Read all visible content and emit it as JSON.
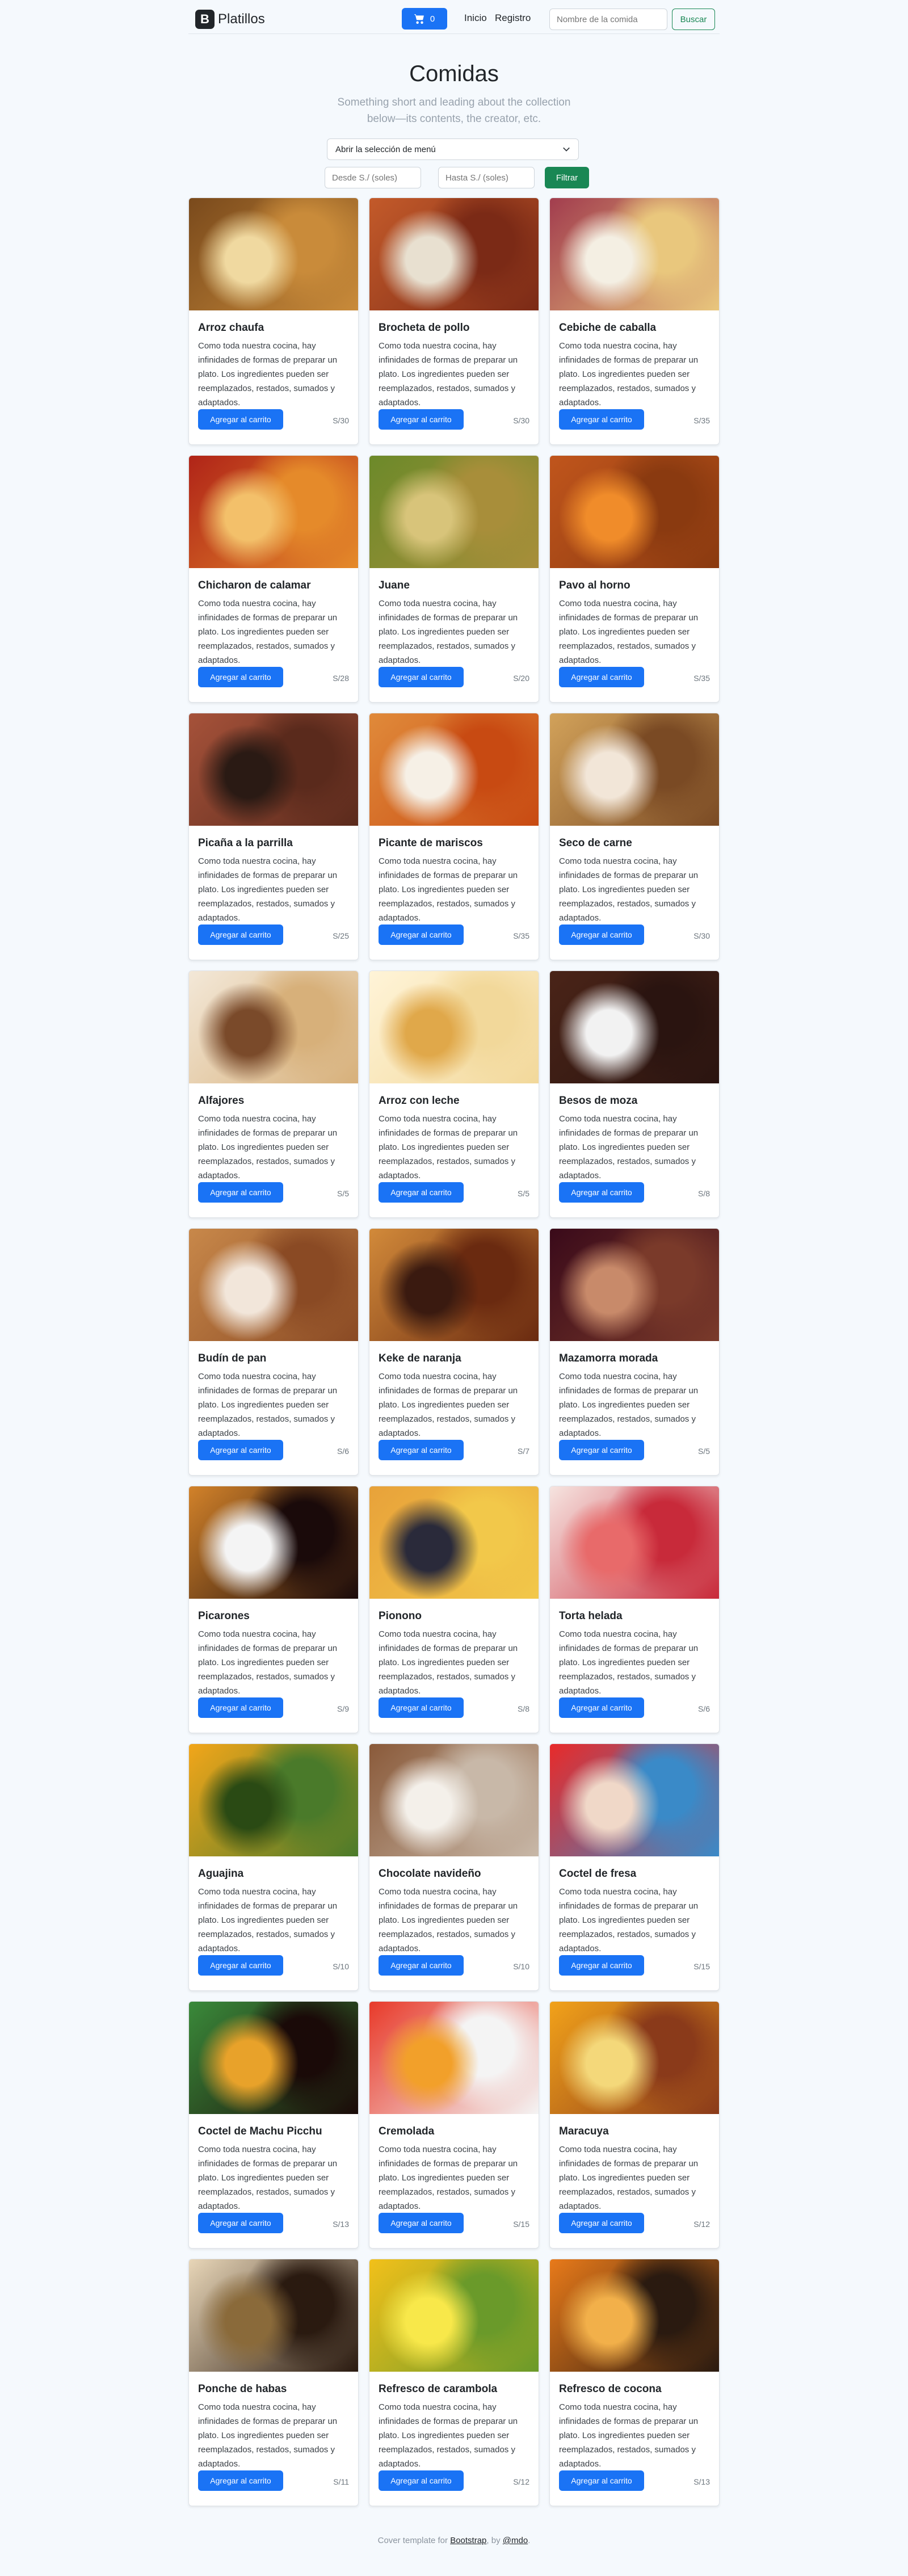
{
  "navbar": {
    "brand_letter": "B",
    "brand": "Platillos",
    "cart_count": "0",
    "links": [
      "Inicio",
      "Registro"
    ],
    "search_placeholder": "Nombre de la comida",
    "search_button": "Buscar"
  },
  "header": {
    "title": "Comidas",
    "lead": "Something short and leading about the collection below—its contents, the creator, etc."
  },
  "filters": {
    "menu_select": "Abrir la selección de menú",
    "from_placeholder": "Desde S./ (soles)",
    "to_placeholder": "Hasta S./ (soles)",
    "filter_button": "Filtrar"
  },
  "card_text": "Como toda nuestra cocina, hay infinidades de formas de preparar un plato. Los ingredientes pueden ser reemplazados, restados, sumados y adaptados.",
  "add_button": "Agregar al carrito",
  "colors": {
    "primary": "#1a73f5",
    "success": "#198754"
  },
  "items": [
    {
      "name": "Arroz chaufa",
      "price": "S/30",
      "c1": "#c98b3a",
      "c2": "#7a4a1c",
      "c3": "#f0d9a0"
    },
    {
      "name": "Brocheta de pollo",
      "price": "S/30",
      "c1": "#7b2a16",
      "c2": "#c35a2a",
      "c3": "#e8e0d0"
    },
    {
      "name": "Cebiche de caballa",
      "price": "S/35",
      "c1": "#e9c77d",
      "c2": "#a23d4e",
      "c3": "#f4efe3"
    },
    {
      "name": "Chicharon de calamar",
      "price": "S/28",
      "c1": "#e58a2a",
      "c2": "#b02418",
      "c3": "#f3c06a"
    },
    {
      "name": "Juane",
      "price": "S/20",
      "c1": "#a88e3a",
      "c2": "#6c8a2a",
      "c3": "#d8c47a"
    },
    {
      "name": "Pavo al horno",
      "price": "S/35",
      "c1": "#8a3a10",
      "c2": "#c0551c",
      "c3": "#f08c2a"
    },
    {
      "name": "Picaña a la parrilla",
      "price": "S/25",
      "c1": "#5a2a1c",
      "c2": "#a6523a",
      "c3": "#2a1a14"
    },
    {
      "name": "Picante de mariscos",
      "price": "S/35",
      "c1": "#c84a12",
      "c2": "#e08a3a",
      "c3": "#f6f0e6"
    },
    {
      "name": "Seco de carne",
      "price": "S/30",
      "c1": "#7a4a24",
      "c2": "#d2a25a",
      "c3": "#f2e6d8"
    },
    {
      "name": "Alfajores",
      "price": "S/5",
      "c1": "#d7b07a",
      "c2": "#f3e8d8",
      "c3": "#7a4a2a"
    },
    {
      "name": "Arroz con leche",
      "price": "S/5",
      "c1": "#f2d89a",
      "c2": "#fff4d8",
      "c3": "#e0a84a"
    },
    {
      "name": "Besos de moza",
      "price": "S/8",
      "c1": "#2a1410",
      "c2": "#4a2418",
      "c3": "#f2f2f2"
    },
    {
      "name": "Budín de pan",
      "price": "S/6",
      "c1": "#8a4a24",
      "c2": "#c8884a",
      "c3": "#f2e6da"
    },
    {
      "name": "Keke de naranja",
      "price": "S/7",
      "c1": "#6a2a10",
      "c2": "#d28a3a",
      "c3": "#3a1a10"
    },
    {
      "name": "Mazamorra morada",
      "price": "S/5",
      "c1": "#7a3a2a",
      "c2": "#3a0a1a",
      "c3": "#c88a6a"
    },
    {
      "name": "Picarones",
      "price": "S/9",
      "c1": "#1a0a0a",
      "c2": "#d2822a",
      "c3": "#f4f4f4"
    },
    {
      "name": "Pionono",
      "price": "S/8",
      "c1": "#f2c84a",
      "c2": "#e8a23a",
      "c3": "#2a2a3a"
    },
    {
      "name": "Torta helada",
      "price": "S/6",
      "c1": "#c82a3a",
      "c2": "#f6e4e0",
      "c3": "#e86a6a"
    },
    {
      "name": "Aguajina",
      "price": "S/10",
      "c1": "#4a7a2a",
      "c2": "#f2a61a",
      "c3": "#2a4a14"
    },
    {
      "name": "Chocolate navideño",
      "price": "S/10",
      "c1": "#c8b8a8",
      "c2": "#8a5a3a",
      "c3": "#f4f0ea"
    },
    {
      "name": "Coctel de fresa",
      "price": "S/15",
      "c1": "#3a8ac8",
      "c2": "#e82a2a",
      "c3": "#f0d8c8"
    },
    {
      "name": "Coctel de Machu Picchu",
      "price": "S/13",
      "c1": "#1a0a08",
      "c2": "#3a8a3a",
      "c3": "#e8a22a"
    },
    {
      "name": "Cremolada",
      "price": "S/15",
      "c1": "#f4f4f4",
      "c2": "#e83a2a",
      "c3": "#f2a02a"
    },
    {
      "name": "Maracuya",
      "price": "S/12",
      "c1": "#8a3a1a",
      "c2": "#f2a21a",
      "c3": "#f4d87a"
    },
    {
      "name": "Ponche de habas",
      "price": "S/11",
      "c1": "#2a1a10",
      "c2": "#e8d6b8",
      "c3": "#8a6a3a"
    },
    {
      "name": "Refresco de carambola",
      "price": "S/12",
      "c1": "#6a9a2a",
      "c2": "#f2c01a",
      "c3": "#f8e84a"
    },
    {
      "name": "Refresco de cocona",
      "price": "S/13",
      "c1": "#2a1a10",
      "c2": "#e87a1a",
      "c3": "#f2b04a"
    }
  ],
  "footer": {
    "prefix": "Cover template for ",
    "link1": "Bootstrap",
    "middle": ", by ",
    "link2": "@mdo",
    "suffix": "."
  }
}
